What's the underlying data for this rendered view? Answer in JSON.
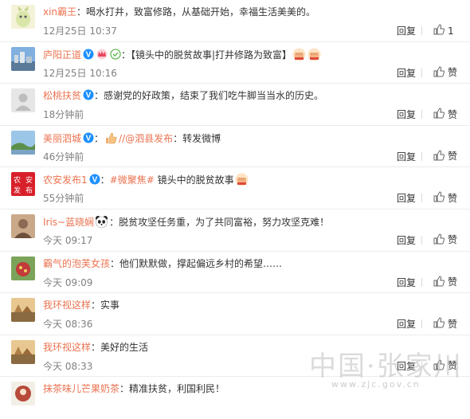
{
  "comments": [
    {
      "name": "xin霸王",
      "text": "：喝水打井，致富修路，从基础开始，幸福生活美美的。",
      "time": "12月25日 10:37",
      "reply": "回复",
      "like": "1"
    },
    {
      "name": "庐阳正道",
      "text_prefix": "：【镜头中的脱贫故事|打井修路为致富】",
      "time": "12月25日 10:16",
      "reply": "回复",
      "like": "赞"
    },
    {
      "name": "松桃扶贫",
      "text": "：感谢党的好政策，结束了我们吃牛脚当当水的历史。",
      "time": "18分钟前",
      "reply": "回复",
      "like": "赞"
    },
    {
      "name": "美丽泗城",
      "text_prefix": "：",
      "at": "//@泗县发布",
      "text_suffix": "：转发微博",
      "time": "46分钟前",
      "reply": "回复",
      "like": "赞"
    },
    {
      "name": "农安发布1",
      "text_prefix": "：",
      "topic": "#微聚焦#",
      "text_suffix": " 镜头中的脱贫故事",
      "time": "55分钟前",
      "reply": "回复",
      "like": "赞"
    },
    {
      "name": "Iris~蓝晓娴",
      "text": "：脱贫攻坚任务重，为了共同富裕，努力攻坚克难！",
      "time": "今天 09:17",
      "reply": "回复",
      "like": "赞"
    },
    {
      "name": "霸气的泡芙女孩",
      "text": "：他们默默做，撑起偏远乡村的希望……",
      "time": "今天 09:09",
      "reply": "回复",
      "like": "赞"
    },
    {
      "name": "我环视这样",
      "text": "：实事",
      "time": "今天 08:36",
      "reply": "回复",
      "like": "赞"
    },
    {
      "name": "我环视这样",
      "text": "：美好的生活",
      "time": "今天 08:33",
      "reply": "回复",
      "like": "赞"
    },
    {
      "name": "抹茶味儿芒果奶茶",
      "text": "：精准扶贫，利国利民！",
      "time": "",
      "reply": "",
      "like": ""
    }
  ],
  "watermark": {
    "cn": "中国·张家川",
    "url": "www.zjc.gov.cn"
  },
  "colors": {
    "name": "#eb7350",
    "text": "#333333",
    "time": "#808080",
    "badge_v": "#ffa000"
  }
}
